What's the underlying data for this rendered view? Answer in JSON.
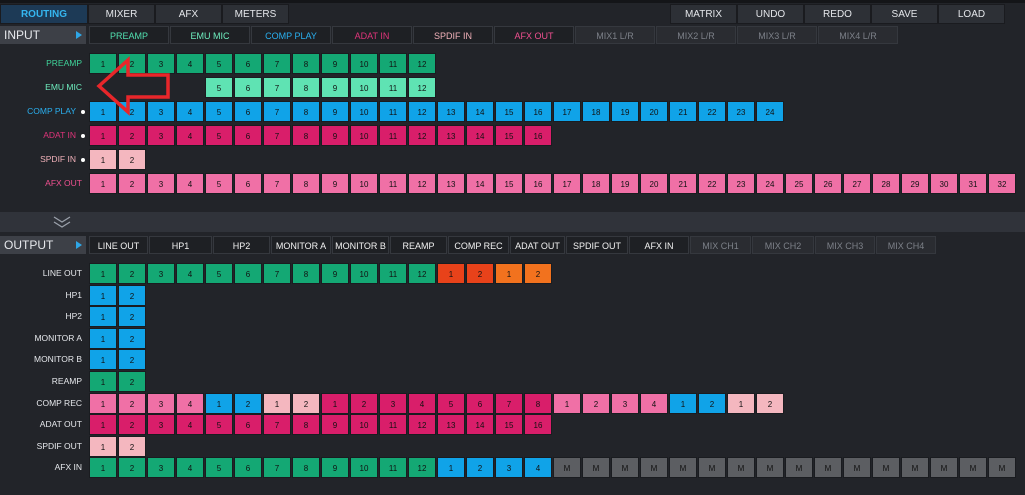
{
  "top_tabs": [
    {
      "label": "ROUTING",
      "active": true
    },
    {
      "label": "MIXER",
      "active": false
    },
    {
      "label": "AFX",
      "active": false
    },
    {
      "label": "METERS",
      "active": false
    }
  ],
  "top_right_buttons": [
    "MATRIX",
    "UNDO",
    "REDO",
    "SAVE",
    "LOAD"
  ],
  "input": {
    "header": "INPUT",
    "buttons": [
      {
        "label": "PREAMP",
        "color": "#52e0b0",
        "dim": false
      },
      {
        "label": "EMU MIC",
        "color": "#6ff0c0",
        "dim": false
      },
      {
        "label": "COMP PLAY",
        "color": "#2ab0f0",
        "dim": false
      },
      {
        "label": "ADAT IN",
        "color": "#e0347a",
        "dim": false
      },
      {
        "label": "SPDIF IN",
        "color": "#f0b0b8",
        "dim": false
      },
      {
        "label": "AFX OUT",
        "color": "#f05090",
        "dim": false
      },
      {
        "label": "MIX1 L/R",
        "color": "#7c8088",
        "dim": true
      },
      {
        "label": "MIX2 L/R",
        "color": "#7c8088",
        "dim": true
      },
      {
        "label": "MIX3 L/R",
        "color": "#7c8088",
        "dim": true
      },
      {
        "label": "MIX4 L/R",
        "color": "#7c8088",
        "dim": true
      }
    ],
    "rows": [
      {
        "label": "PREAMP",
        "label_color": "#3fd49a",
        "dot": false,
        "start": 0,
        "cells": [
          {
            "t": "1",
            "c": "#14a874"
          },
          {
            "t": "2",
            "c": "#14a874"
          },
          {
            "t": "3",
            "c": "#14a874"
          },
          {
            "t": "4",
            "c": "#14a874"
          },
          {
            "t": "5",
            "c": "#14a874"
          },
          {
            "t": "6",
            "c": "#14a874"
          },
          {
            "t": "7",
            "c": "#14a874"
          },
          {
            "t": "8",
            "c": "#14a874"
          },
          {
            "t": "9",
            "c": "#14a874"
          },
          {
            "t": "10",
            "c": "#14a874"
          },
          {
            "t": "11",
            "c": "#14a874"
          },
          {
            "t": "12",
            "c": "#14a874"
          }
        ]
      },
      {
        "label": "EMU MIC",
        "label_color": "#6ff0c0",
        "dot": false,
        "start": 4,
        "cells": [
          {
            "t": "5",
            "c": "#5fe3b3"
          },
          {
            "t": "6",
            "c": "#5fe3b3"
          },
          {
            "t": "7",
            "c": "#5fe3b3"
          },
          {
            "t": "8",
            "c": "#5fe3b3"
          },
          {
            "t": "9",
            "c": "#5fe3b3"
          },
          {
            "t": "10",
            "c": "#5fe3b3"
          },
          {
            "t": "11",
            "c": "#5fe3b3"
          },
          {
            "t": "12",
            "c": "#5fe3b3"
          }
        ]
      },
      {
        "label": "COMP PLAY",
        "label_color": "#2ab0f0",
        "dot": true,
        "start": 0,
        "cells": [
          {
            "t": "1",
            "c": "#10a3e8"
          },
          {
            "t": "2",
            "c": "#10a3e8"
          },
          {
            "t": "3",
            "c": "#10a3e8"
          },
          {
            "t": "4",
            "c": "#10a3e8"
          },
          {
            "t": "5",
            "c": "#10a3e8"
          },
          {
            "t": "6",
            "c": "#10a3e8"
          },
          {
            "t": "7",
            "c": "#10a3e8"
          },
          {
            "t": "8",
            "c": "#10a3e8"
          },
          {
            "t": "9",
            "c": "#10a3e8"
          },
          {
            "t": "10",
            "c": "#10a3e8"
          },
          {
            "t": "11",
            "c": "#10a3e8"
          },
          {
            "t": "12",
            "c": "#10a3e8"
          },
          {
            "t": "13",
            "c": "#10a3e8"
          },
          {
            "t": "14",
            "c": "#10a3e8"
          },
          {
            "t": "15",
            "c": "#10a3e8"
          },
          {
            "t": "16",
            "c": "#10a3e8"
          },
          {
            "t": "17",
            "c": "#10a3e8"
          },
          {
            "t": "18",
            "c": "#10a3e8"
          },
          {
            "t": "19",
            "c": "#10a3e8"
          },
          {
            "t": "20",
            "c": "#10a3e8"
          },
          {
            "t": "21",
            "c": "#10a3e8"
          },
          {
            "t": "22",
            "c": "#10a3e8"
          },
          {
            "t": "23",
            "c": "#10a3e8"
          },
          {
            "t": "24",
            "c": "#10a3e8"
          }
        ]
      },
      {
        "label": "ADAT IN",
        "label_color": "#e0347a",
        "dot": true,
        "start": 0,
        "cells": [
          {
            "t": "1",
            "c": "#d91e6a"
          },
          {
            "t": "2",
            "c": "#d91e6a"
          },
          {
            "t": "3",
            "c": "#d91e6a"
          },
          {
            "t": "4",
            "c": "#d91e6a"
          },
          {
            "t": "5",
            "c": "#d91e6a"
          },
          {
            "t": "6",
            "c": "#d91e6a"
          },
          {
            "t": "7",
            "c": "#d91e6a"
          },
          {
            "t": "8",
            "c": "#d91e6a"
          },
          {
            "t": "9",
            "c": "#d91e6a"
          },
          {
            "t": "10",
            "c": "#d91e6a"
          },
          {
            "t": "11",
            "c": "#d91e6a"
          },
          {
            "t": "12",
            "c": "#d91e6a"
          },
          {
            "t": "13",
            "c": "#d91e6a"
          },
          {
            "t": "14",
            "c": "#d91e6a"
          },
          {
            "t": "15",
            "c": "#d91e6a"
          },
          {
            "t": "16",
            "c": "#d91e6a"
          }
        ]
      },
      {
        "label": "SPDIF IN",
        "label_color": "#f0b0b8",
        "dot": true,
        "start": 0,
        "cells": [
          {
            "t": "1",
            "c": "#f4b7bf"
          },
          {
            "t": "2",
            "c": "#f4b7bf"
          }
        ]
      },
      {
        "label": "AFX OUT",
        "label_color": "#f05090",
        "dot": false,
        "start": 0,
        "cells": [
          {
            "t": "1",
            "c": "#f070a6"
          },
          {
            "t": "2",
            "c": "#f070a6"
          },
          {
            "t": "3",
            "c": "#f070a6"
          },
          {
            "t": "4",
            "c": "#f070a6"
          },
          {
            "t": "5",
            "c": "#f070a6"
          },
          {
            "t": "6",
            "c": "#f070a6"
          },
          {
            "t": "7",
            "c": "#f070a6"
          },
          {
            "t": "8",
            "c": "#f070a6"
          },
          {
            "t": "9",
            "c": "#f070a6"
          },
          {
            "t": "10",
            "c": "#f070a6"
          },
          {
            "t": "11",
            "c": "#f070a6"
          },
          {
            "t": "12",
            "c": "#f070a6"
          },
          {
            "t": "13",
            "c": "#f070a6"
          },
          {
            "t": "14",
            "c": "#f070a6"
          },
          {
            "t": "15",
            "c": "#f070a6"
          },
          {
            "t": "16",
            "c": "#f070a6"
          },
          {
            "t": "17",
            "c": "#f070a6"
          },
          {
            "t": "18",
            "c": "#f070a6"
          },
          {
            "t": "19",
            "c": "#f070a6"
          },
          {
            "t": "20",
            "c": "#f070a6"
          },
          {
            "t": "21",
            "c": "#f070a6"
          },
          {
            "t": "22",
            "c": "#f070a6"
          },
          {
            "t": "23",
            "c": "#f070a6"
          },
          {
            "t": "24",
            "c": "#f070a6"
          },
          {
            "t": "25",
            "c": "#f070a6"
          },
          {
            "t": "26",
            "c": "#f070a6"
          },
          {
            "t": "27",
            "c": "#f070a6"
          },
          {
            "t": "28",
            "c": "#f070a6"
          },
          {
            "t": "29",
            "c": "#f070a6"
          },
          {
            "t": "30",
            "c": "#f070a6"
          },
          {
            "t": "31",
            "c": "#f070a6"
          },
          {
            "t": "32",
            "c": "#f070a6"
          }
        ]
      }
    ]
  },
  "output": {
    "header": "OUTPUT",
    "buttons": [
      {
        "label": "LINE OUT",
        "color": "#f2f2f2",
        "dim": false
      },
      {
        "label": "HP1",
        "color": "#f2f2f2",
        "dim": false
      },
      {
        "label": "HP2",
        "color": "#f2f2f2",
        "dim": false
      },
      {
        "label": "MONITOR A",
        "color": "#f2f2f2",
        "dim": false
      },
      {
        "label": "MONITOR B",
        "color": "#f2f2f2",
        "dim": false
      },
      {
        "label": "REAMP",
        "color": "#f2f2f2",
        "dim": false
      },
      {
        "label": "COMP REC",
        "color": "#f2f2f2",
        "dim": false
      },
      {
        "label": "ADAT OUT",
        "color": "#f2f2f2",
        "dim": false
      },
      {
        "label": "SPDIF OUT",
        "color": "#f2f2f2",
        "dim": false
      },
      {
        "label": "AFX IN",
        "color": "#f2f2f2",
        "dim": false
      },
      {
        "label": "MIX CH1",
        "color": "#7c8088",
        "dim": true
      },
      {
        "label": "MIX CH2",
        "color": "#7c8088",
        "dim": true
      },
      {
        "label": "MIX CH3",
        "color": "#7c8088",
        "dim": true
      },
      {
        "label": "MIX CH4",
        "color": "#7c8088",
        "dim": true
      }
    ],
    "rows": [
      {
        "label": "LINE OUT",
        "start": 0,
        "cells": [
          {
            "t": "1",
            "c": "#14a874"
          },
          {
            "t": "2",
            "c": "#14a874"
          },
          {
            "t": "3",
            "c": "#14a874"
          },
          {
            "t": "4",
            "c": "#14a874"
          },
          {
            "t": "5",
            "c": "#14a874"
          },
          {
            "t": "6",
            "c": "#14a874"
          },
          {
            "t": "7",
            "c": "#14a874"
          },
          {
            "t": "8",
            "c": "#14a874"
          },
          {
            "t": "9",
            "c": "#14a874"
          },
          {
            "t": "10",
            "c": "#14a874"
          },
          {
            "t": "11",
            "c": "#14a874"
          },
          {
            "t": "12",
            "c": "#14a874"
          },
          {
            "t": "1",
            "c": "#e8421a"
          },
          {
            "t": "2",
            "c": "#e8421a"
          },
          {
            "t": "1",
            "c": "#f2721e"
          },
          {
            "t": "2",
            "c": "#f2721e"
          }
        ]
      },
      {
        "label": "HP1",
        "start": 0,
        "cells": [
          {
            "t": "1",
            "c": "#10a3e8"
          },
          {
            "t": "2",
            "c": "#10a3e8"
          }
        ]
      },
      {
        "label": "HP2",
        "start": 0,
        "cells": [
          {
            "t": "1",
            "c": "#10a3e8"
          },
          {
            "t": "2",
            "c": "#10a3e8"
          }
        ]
      },
      {
        "label": "MONITOR A",
        "start": 0,
        "cells": [
          {
            "t": "1",
            "c": "#10a3e8"
          },
          {
            "t": "2",
            "c": "#10a3e8"
          }
        ]
      },
      {
        "label": "MONITOR B",
        "start": 0,
        "cells": [
          {
            "t": "1",
            "c": "#10a3e8"
          },
          {
            "t": "2",
            "c": "#10a3e8"
          }
        ]
      },
      {
        "label": "REAMP",
        "start": 0,
        "cells": [
          {
            "t": "1",
            "c": "#14a874"
          },
          {
            "t": "2",
            "c": "#14a874"
          }
        ]
      },
      {
        "label": "COMP REC",
        "start": 0,
        "cells": [
          {
            "t": "1",
            "c": "#f070a6"
          },
          {
            "t": "2",
            "c": "#f070a6"
          },
          {
            "t": "3",
            "c": "#f070a6"
          },
          {
            "t": "4",
            "c": "#f070a6"
          },
          {
            "t": "1",
            "c": "#10a3e8"
          },
          {
            "t": "2",
            "c": "#10a3e8"
          },
          {
            "t": "1",
            "c": "#f4b7bf"
          },
          {
            "t": "2",
            "c": "#f4b7bf"
          },
          {
            "t": "1",
            "c": "#d91e6a"
          },
          {
            "t": "2",
            "c": "#d91e6a"
          },
          {
            "t": "3",
            "c": "#d91e6a"
          },
          {
            "t": "4",
            "c": "#d91e6a"
          },
          {
            "t": "5",
            "c": "#d91e6a"
          },
          {
            "t": "6",
            "c": "#d91e6a"
          },
          {
            "t": "7",
            "c": "#d91e6a"
          },
          {
            "t": "8",
            "c": "#d91e6a"
          },
          {
            "t": "1",
            "c": "#f070a6"
          },
          {
            "t": "2",
            "c": "#f070a6"
          },
          {
            "t": "3",
            "c": "#f070a6"
          },
          {
            "t": "4",
            "c": "#f070a6"
          },
          {
            "t": "1",
            "c": "#10a3e8"
          },
          {
            "t": "2",
            "c": "#10a3e8"
          },
          {
            "t": "1",
            "c": "#f4b7bf"
          },
          {
            "t": "2",
            "c": "#f4b7bf"
          }
        ]
      },
      {
        "label": "ADAT OUT",
        "start": 0,
        "cells": [
          {
            "t": "1",
            "c": "#d91e6a"
          },
          {
            "t": "2",
            "c": "#d91e6a"
          },
          {
            "t": "3",
            "c": "#d91e6a"
          },
          {
            "t": "4",
            "c": "#d91e6a"
          },
          {
            "t": "5",
            "c": "#d91e6a"
          },
          {
            "t": "6",
            "c": "#d91e6a"
          },
          {
            "t": "7",
            "c": "#d91e6a"
          },
          {
            "t": "8",
            "c": "#d91e6a"
          },
          {
            "t": "9",
            "c": "#d91e6a"
          },
          {
            "t": "10",
            "c": "#d91e6a"
          },
          {
            "t": "11",
            "c": "#d91e6a"
          },
          {
            "t": "12",
            "c": "#d91e6a"
          },
          {
            "t": "13",
            "c": "#d91e6a"
          },
          {
            "t": "14",
            "c": "#d91e6a"
          },
          {
            "t": "15",
            "c": "#d91e6a"
          },
          {
            "t": "16",
            "c": "#d91e6a"
          }
        ]
      },
      {
        "label": "SPDIF OUT",
        "start": 0,
        "cells": [
          {
            "t": "1",
            "c": "#f4b7bf"
          },
          {
            "t": "2",
            "c": "#f4b7bf"
          }
        ]
      },
      {
        "label": "AFX IN",
        "start": 0,
        "cells": [
          {
            "t": "1",
            "c": "#14a874"
          },
          {
            "t": "2",
            "c": "#14a874"
          },
          {
            "t": "3",
            "c": "#14a874"
          },
          {
            "t": "4",
            "c": "#14a874"
          },
          {
            "t": "5",
            "c": "#14a874"
          },
          {
            "t": "6",
            "c": "#14a874"
          },
          {
            "t": "7",
            "c": "#14a874"
          },
          {
            "t": "8",
            "c": "#14a874"
          },
          {
            "t": "9",
            "c": "#14a874"
          },
          {
            "t": "10",
            "c": "#14a874"
          },
          {
            "t": "11",
            "c": "#14a874"
          },
          {
            "t": "12",
            "c": "#14a874"
          },
          {
            "t": "1",
            "c": "#10a3e8"
          },
          {
            "t": "2",
            "c": "#10a3e8"
          },
          {
            "t": "3",
            "c": "#10a3e8"
          },
          {
            "t": "4",
            "c": "#10a3e8"
          },
          {
            "t": "M",
            "c": "#5c5e62"
          },
          {
            "t": "M",
            "c": "#5c5e62"
          },
          {
            "t": "M",
            "c": "#5c5e62"
          },
          {
            "t": "M",
            "c": "#5c5e62"
          },
          {
            "t": "M",
            "c": "#5c5e62"
          },
          {
            "t": "M",
            "c": "#5c5e62"
          },
          {
            "t": "M",
            "c": "#5c5e62"
          },
          {
            "t": "M",
            "c": "#5c5e62"
          },
          {
            "t": "M",
            "c": "#5c5e62"
          },
          {
            "t": "M",
            "c": "#5c5e62"
          },
          {
            "t": "M",
            "c": "#5c5e62"
          },
          {
            "t": "M",
            "c": "#5c5e62"
          },
          {
            "t": "M",
            "c": "#5c5e62"
          },
          {
            "t": "M",
            "c": "#5c5e62"
          },
          {
            "t": "M",
            "c": "#5c5e62"
          },
          {
            "t": "M",
            "c": "#5c5e62"
          }
        ]
      }
    ]
  },
  "overlay_arrow_color": "#e8262a",
  "divider_icon": "double-chevron-down-icon"
}
